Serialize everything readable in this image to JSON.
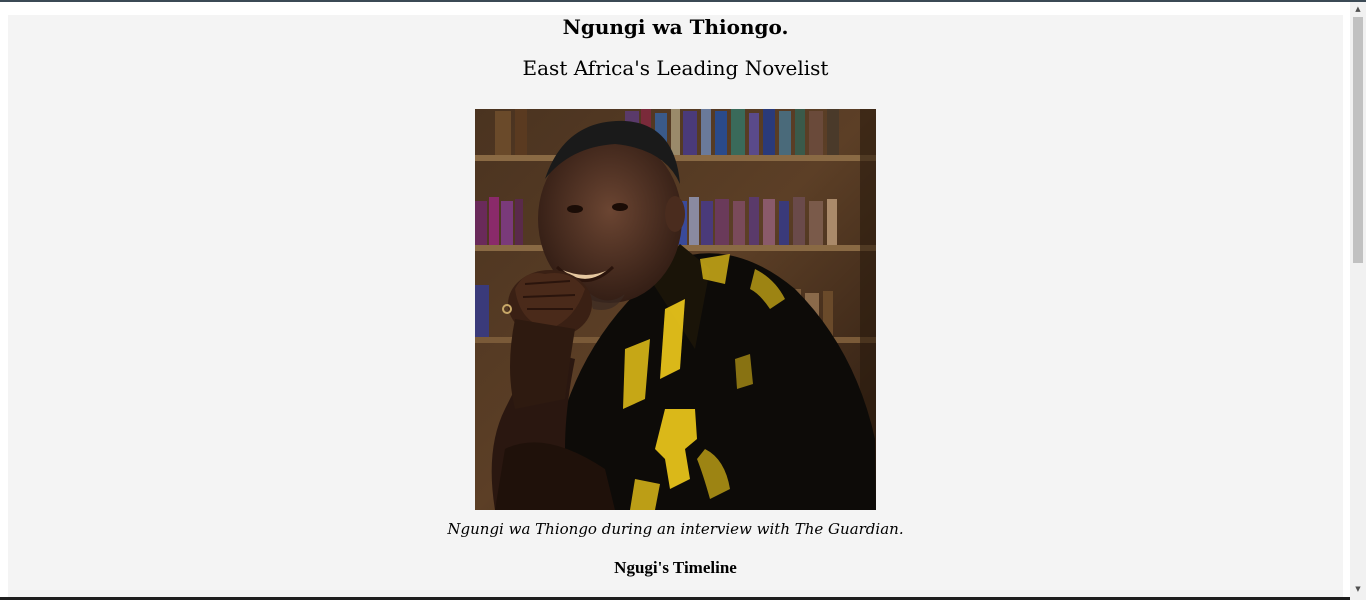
{
  "page": {
    "title": "Ngungi wa Thiongo.",
    "subtitle": "East Africa's Leading Novelist"
  },
  "image": {
    "alt": "Ngungi wa Thiongo portrait"
  },
  "caption": "Ngungi wa Thiongo during an interview with The Guardian.",
  "section_title": "Ngugi's Timeline",
  "scrollbar": {
    "up_arrow": "▲",
    "down_arrow": "▼",
    "position_fraction": 0.0
  },
  "colors": {
    "page_background": "#f4f4f4",
    "shirt": "#0d0b08",
    "shirt_pattern": "#e6c21a",
    "bookshelf": "#6b4a2a"
  }
}
